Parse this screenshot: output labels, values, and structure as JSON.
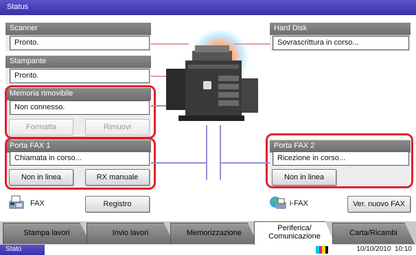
{
  "titlebar": {
    "title": "Status"
  },
  "devices": {
    "scanner": {
      "label": "Scanner",
      "status": "Pronto."
    },
    "printer": {
      "label": "Stampante",
      "status": "Pronto."
    },
    "removable_memory": {
      "label": "Memoria rimovibile",
      "status": "Non connesso.",
      "format_button": "Formatta",
      "remove_button": "Rimuovi"
    },
    "hard_disk": {
      "label": "Hard Disk",
      "status": "Sovrascrittura in corso..."
    },
    "fax_port_1": {
      "label": "Porta FAX 1",
      "status": "Chiamata in corso...",
      "offline_button": "Non in linea",
      "manual_rx_button": "RX manuale"
    },
    "fax_port_2": {
      "label": "Porta FAX 2",
      "status": "Ricezione in corso...",
      "offline_button": "Non in linea"
    }
  },
  "footer_row": {
    "fax_label": "FAX",
    "log_button": "Registro",
    "ifax_label": "i-FAX",
    "check_new_fax_button": "Ver. nuovo FAX"
  },
  "tabs": [
    {
      "label": "Stampa lavori"
    },
    {
      "label": "Invio lavori"
    },
    {
      "label": "Memorizzazione"
    },
    {
      "label_line1": "Periferica/",
      "label_line2": "Comunicazione",
      "active": true
    },
    {
      "label": "Carta/Ricambi"
    }
  ],
  "statusbar": {
    "status_label": "Stato",
    "datetime": "10/10/2010  10:10",
    "toner_colors": [
      "#00c8e8",
      "#e8168c",
      "#f0e010",
      "#111111"
    ]
  },
  "colors": {
    "accent": "#3a30a8",
    "highlight": "#e0202a",
    "panel_header": "#7a7a7a"
  }
}
